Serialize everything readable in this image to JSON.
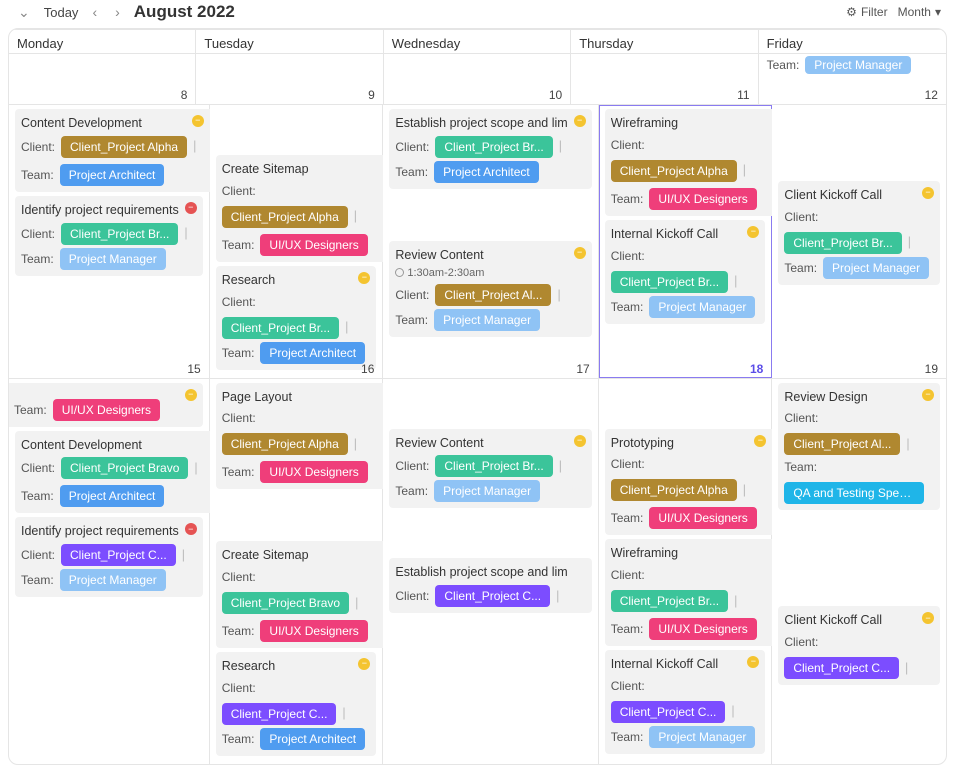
{
  "header": {
    "today": "Today",
    "prev": "‹",
    "next": "›",
    "month": "August 2022",
    "filter_icon": "⚙",
    "filter": "Filter",
    "view": "Month",
    "view_caret": "▾"
  },
  "days": [
    "Monday",
    "Tuesday",
    "Wednesday",
    "Thursday",
    "Friday"
  ],
  "labels": {
    "client": "Client:",
    "team": "Team:"
  },
  "clients": {
    "alpha": "Client_Project Alpha",
    "alpha_s": "Client_Project Al...",
    "bravo": "Client_Project Bravo",
    "bravo_s": "Client_Project Br...",
    "charlie_s": "Client_Project C..."
  },
  "teams": {
    "arch": "Project Architect",
    "pm": "Project Manager",
    "ux": "UI/UX Designers",
    "qa": "QA and Testing Special"
  },
  "titles": {
    "content_dev": "Content Development",
    "identify_req": "Identify project requirements",
    "create_sitemap": "Create Sitemap",
    "research": "Research",
    "establish_scope": "Establish project scope and lim",
    "review_content": "Review Content",
    "wireframing": "Wireframing",
    "internal_kickoff": "Internal Kickoff Call",
    "client_kickoff": "Client Kickoff Call",
    "page_layout": "Page Layout",
    "review_design": "Review Design",
    "prototyping": "Prototyping"
  },
  "times": {
    "review_content": "1:30am-2:30am"
  },
  "dates": {
    "w1": [
      "8",
      "9",
      "10",
      "11",
      "12"
    ],
    "w2": [
      "15",
      "16",
      "17",
      "18",
      "19"
    ]
  }
}
